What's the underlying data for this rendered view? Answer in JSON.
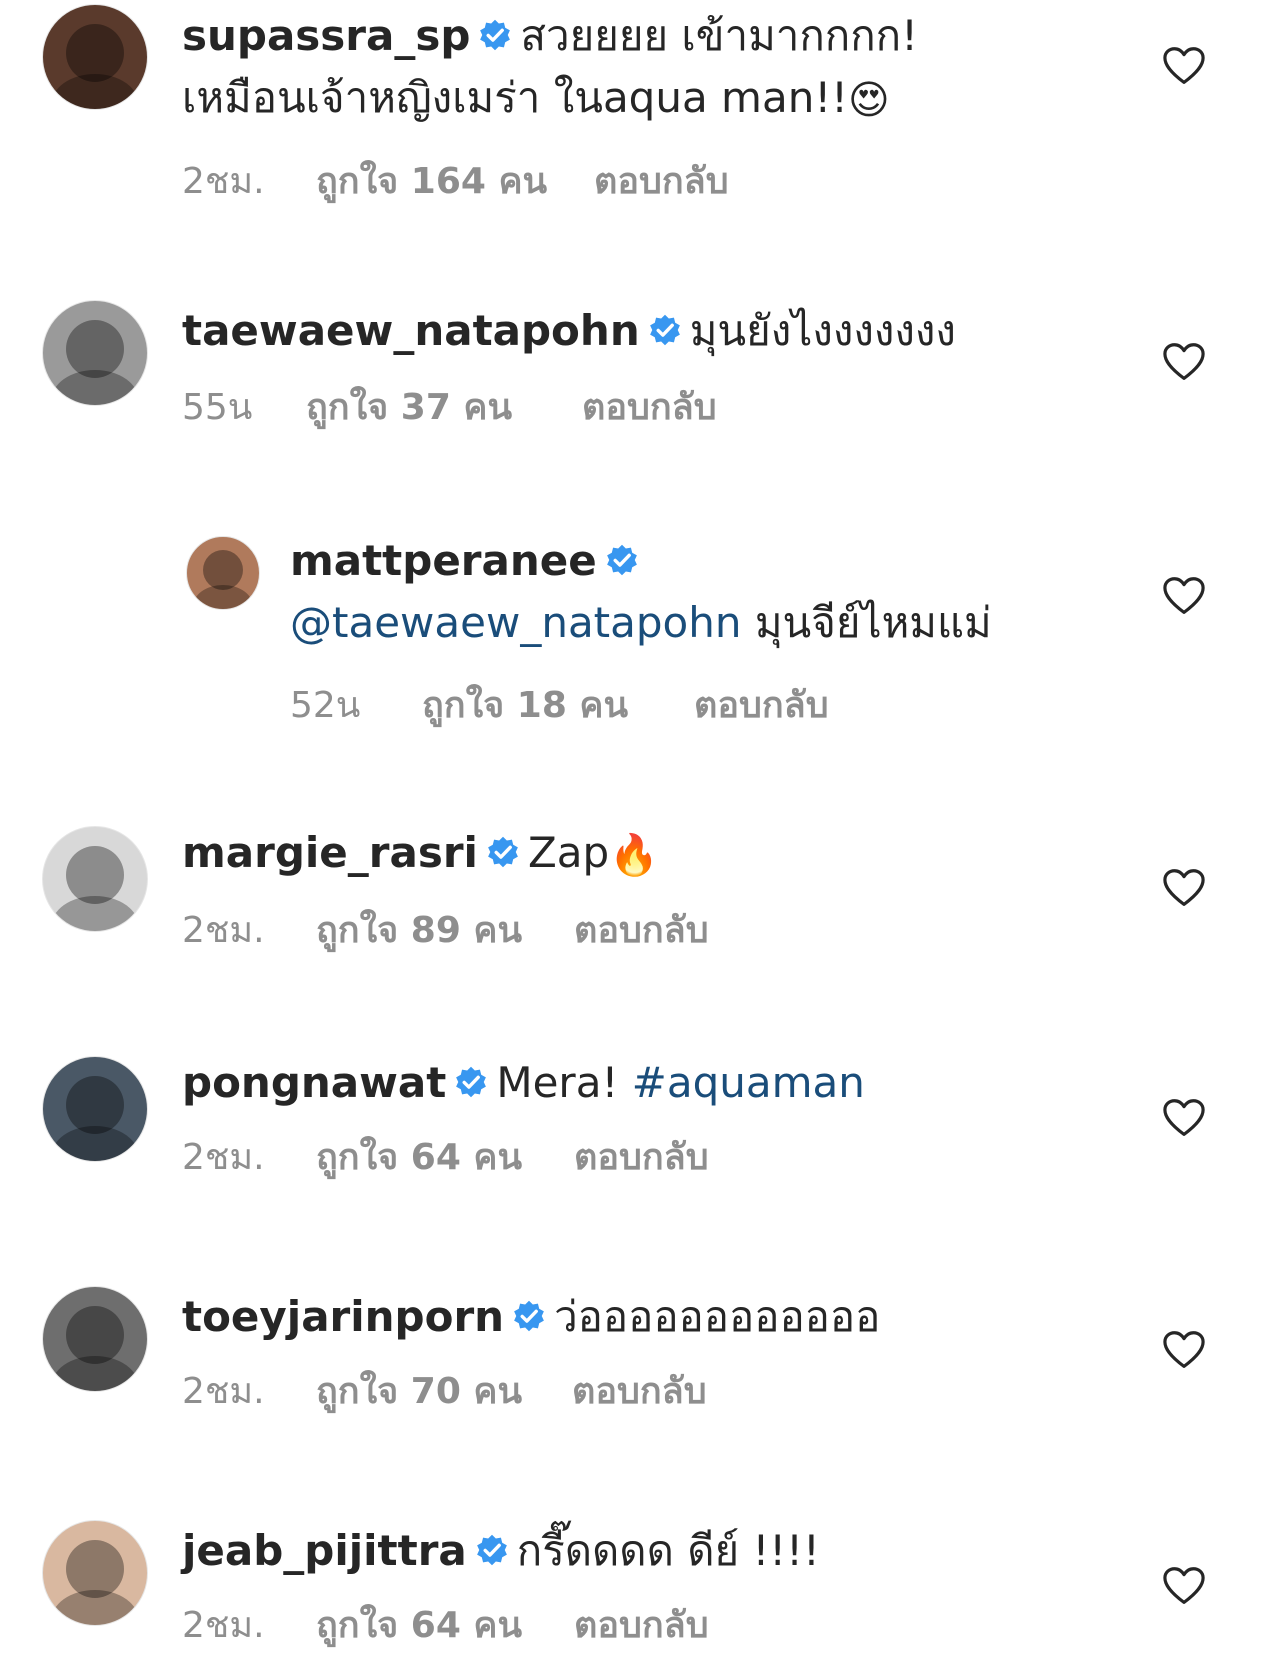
{
  "comments": [
    {
      "username": "supassra_sp",
      "text_line1": "สวยยยย เข้ามากกกก!",
      "text_line2": "เหมือนเจ้าหญิงเมร่า ในaqua man!!",
      "emoji": "😍",
      "time": "2ชม.",
      "likes": "ถูกใจ 164 คน",
      "reply": "ตอบกลับ",
      "avatar_color": "#5a3a2c"
    },
    {
      "username": "taewaew_natapohn",
      "text": "มุนยังไงงงงงงง",
      "time": "55น",
      "likes": "ถูกใจ 37 คน",
      "reply": "ตอบกลับ",
      "avatar_color": "#9a9a9a"
    },
    {
      "username": "mattperanee",
      "mention": "@taewaew_natapohn",
      "text": "มุนจีย์ไหมแม่",
      "time": "52น",
      "likes": "ถูกใจ 18 คน",
      "reply": "ตอบกลับ",
      "avatar_color": "#b07a5c"
    },
    {
      "username": "margie_rasri",
      "text": "Zap",
      "emoji": "🔥",
      "time": "2ชม.",
      "likes": "ถูกใจ 89 คน",
      "reply": "ตอบกลับ",
      "avatar_color": "#d8d8d8"
    },
    {
      "username": "pongnawat",
      "text": "Mera!",
      "hashtag": "#aquaman",
      "time": "2ชม.",
      "likes": "ถูกใจ 64 คน",
      "reply": "ตอบกลับ",
      "avatar_color": "#4a5866"
    },
    {
      "username": "toeyjarinporn",
      "text": "ว่ออออออออออออ",
      "time": "2ชม.",
      "likes": "ถูกใจ 70 คน",
      "reply": "ตอบกลับ",
      "avatar_color": "#6e6e6e"
    },
    {
      "username": "jeab_pijittra",
      "text": "กรี๊ดดดด ดีย์ !!!!",
      "time": "2ชม.",
      "likes": "ถูกใจ 64 คน",
      "reply": "ตอบกลับ",
      "avatar_color": "#d9b8a0"
    }
  ],
  "colors": {
    "verified": "#3897f0",
    "link": "#1a4d7a",
    "meta": "#8e8e8e",
    "heart": "#262626"
  },
  "icons": {
    "verified": "verified-badge-icon",
    "like": "heart-outline-icon",
    "avatar": "user-avatar"
  }
}
